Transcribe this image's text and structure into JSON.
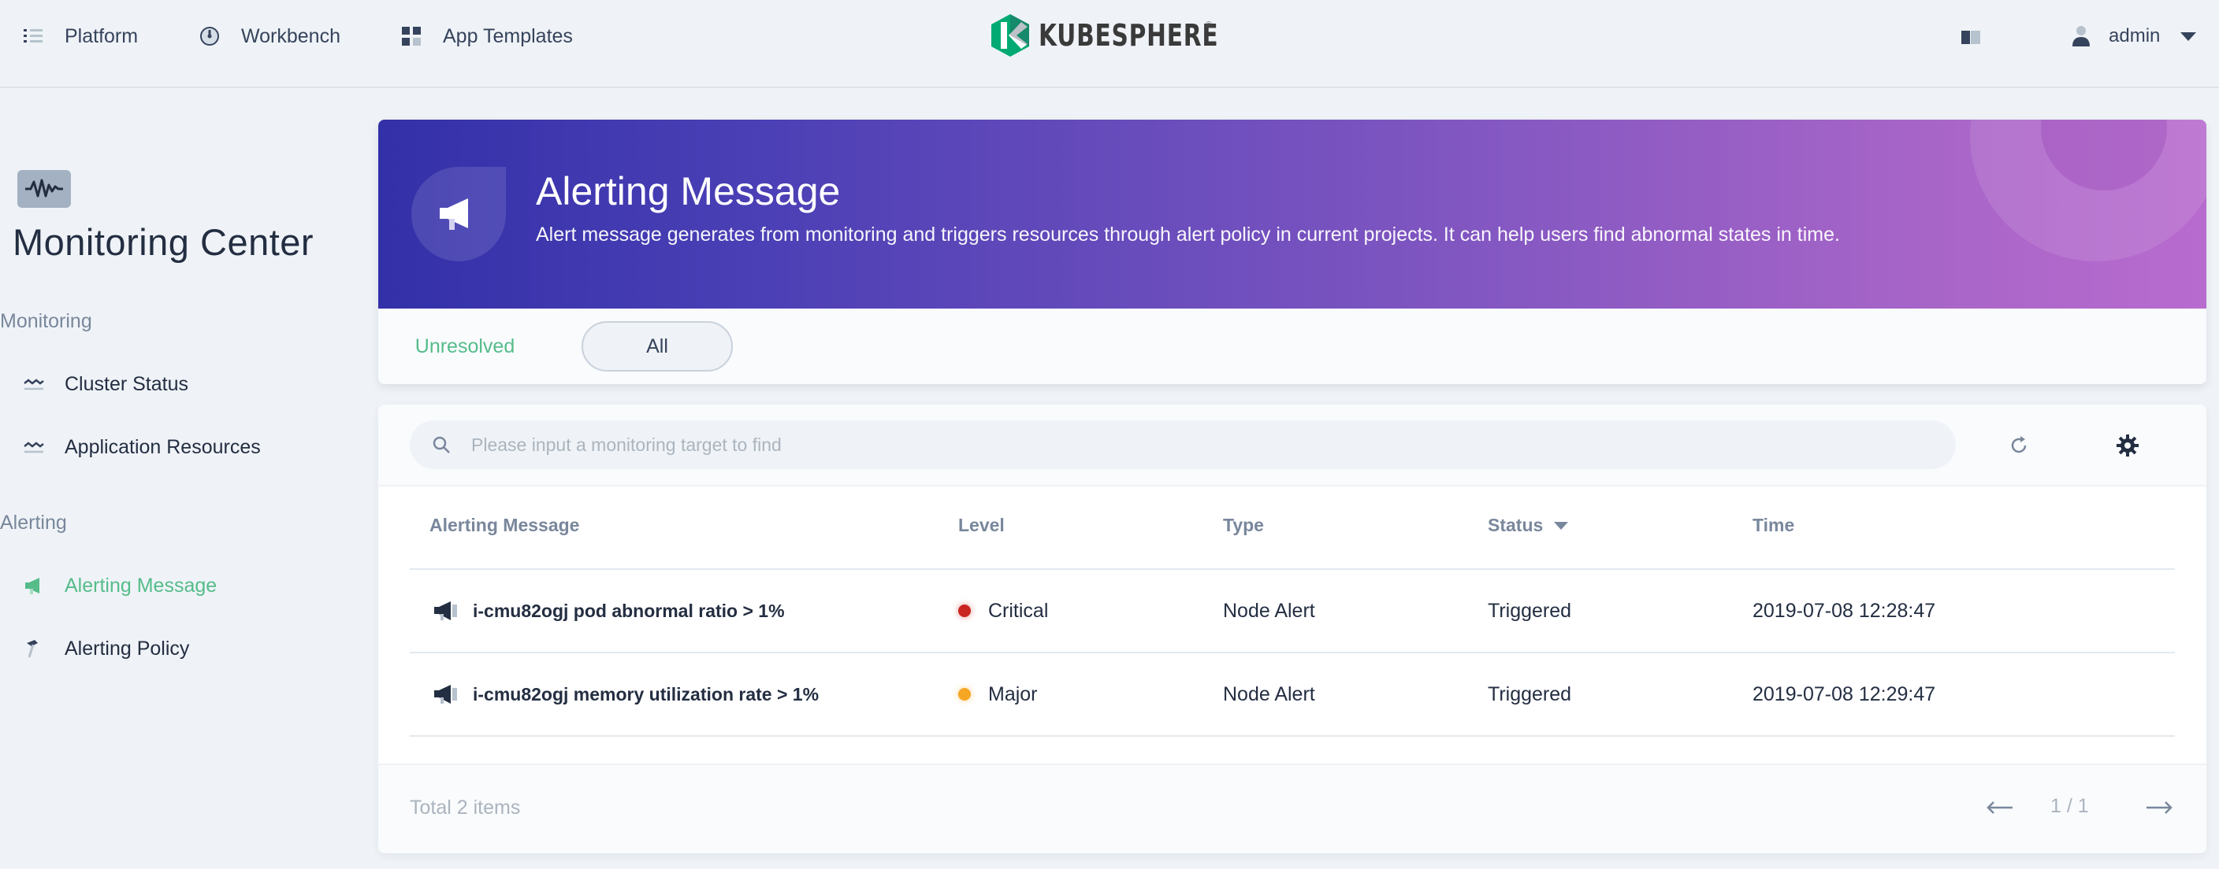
{
  "topnav": {
    "items": [
      {
        "label": "Platform",
        "icon": "list-icon"
      },
      {
        "label": "Workbench",
        "icon": "dashboard-icon"
      },
      {
        "label": "App Templates",
        "icon": "grid-icon"
      }
    ],
    "logo_text": "KUBESPHERE",
    "logo_mark": "®",
    "user": "admin"
  },
  "sidebar": {
    "title": "Monitoring Center",
    "groups": [
      {
        "label": "Monitoring",
        "items": [
          {
            "label": "Cluster Status",
            "icon": "wave-icon"
          },
          {
            "label": "Application Resources",
            "icon": "wave-icon"
          }
        ]
      },
      {
        "label": "Alerting",
        "items": [
          {
            "label": "Alerting Message",
            "icon": "megaphone-icon",
            "active": true
          },
          {
            "label": "Alerting Policy",
            "icon": "hammer-icon"
          }
        ]
      }
    ]
  },
  "banner": {
    "title": "Alerting Message",
    "description": "Alert message generates from monitoring and triggers resources through alert policy in current projects. It can help users find abnormal states in time."
  },
  "tabs": [
    {
      "label": "Unresolved",
      "active": false
    },
    {
      "label": "All",
      "active": true
    }
  ],
  "search": {
    "placeholder": "Please input a monitoring target to find",
    "value": ""
  },
  "table": {
    "headers": [
      "Alerting Message",
      "Level",
      "Type",
      "Status",
      "Time"
    ],
    "rows": [
      {
        "message": "i-cmu82ogj pod abnormal ratio > 1%",
        "level": "Critical",
        "level_color": "#ca2621",
        "type": "Node Alert",
        "status": "Triggered",
        "time": "2019-07-08 12:28:47"
      },
      {
        "message": "i-cmu82ogj memory utilization rate > 1%",
        "level": "Major",
        "level_color": "#f5a623",
        "type": "Node Alert",
        "status": "Triggered",
        "time": "2019-07-08 12:29:47"
      }
    ]
  },
  "footer": {
    "total": "Total 2 items",
    "page": "1 / 1"
  },
  "colors": {
    "accent": "#55bc8a",
    "banner_start": "#3330a8",
    "banner_end": "#b86bce"
  }
}
